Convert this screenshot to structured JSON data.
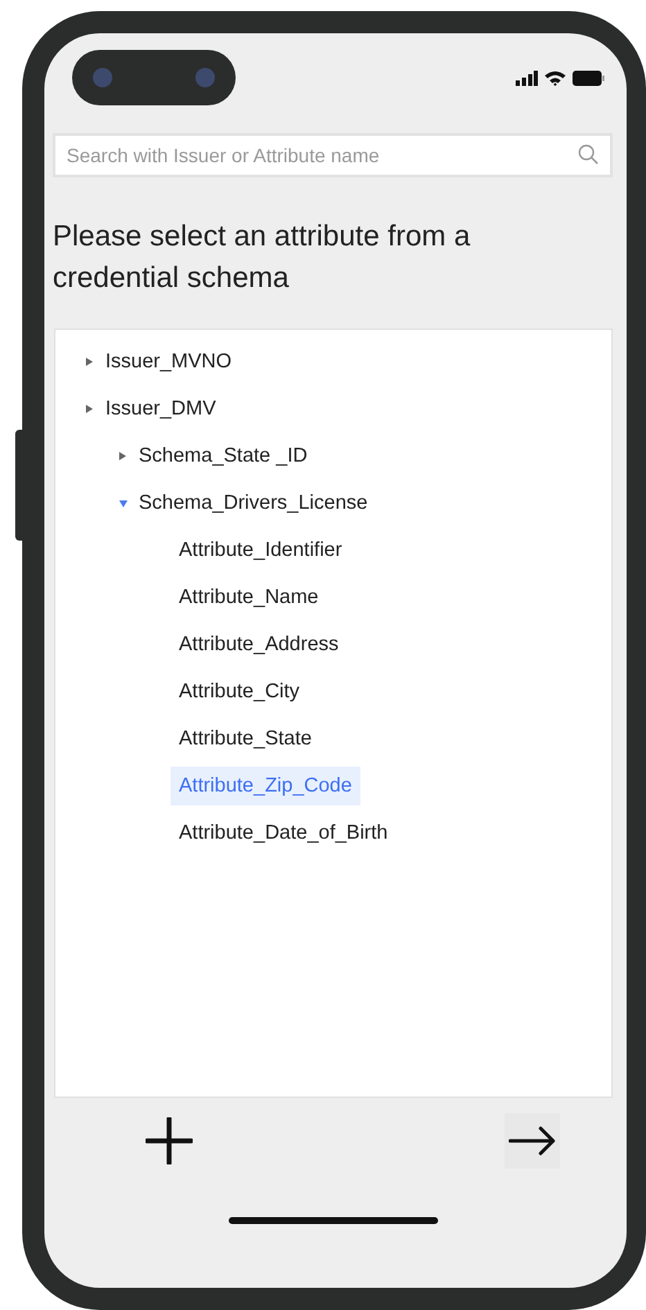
{
  "search": {
    "placeholder": "Search with Issuer or Attribute name"
  },
  "heading": "Please select an attribute from a credential schema",
  "tree": [
    {
      "label": "Issuer_MVNO",
      "expanded": false
    },
    {
      "label": "Issuer_DMV",
      "expanded": false,
      "children": [
        {
          "label": "Schema_State _ID",
          "expanded": false
        },
        {
          "label": "Schema_Drivers_License",
          "expanded": true,
          "children": [
            {
              "label": "Attribute_Identifier",
              "selected": false
            },
            {
              "label": "Attribute_Name",
              "selected": false
            },
            {
              "label": "Attribute_Address",
              "selected": false
            },
            {
              "label": "Attribute_City",
              "selected": false
            },
            {
              "label": "Attribute_State",
              "selected": false
            },
            {
              "label": "Attribute_Zip_Code",
              "selected": true
            },
            {
              "label": "Attribute_Date_of_Birth",
              "selected": false
            }
          ]
        }
      ]
    }
  ]
}
